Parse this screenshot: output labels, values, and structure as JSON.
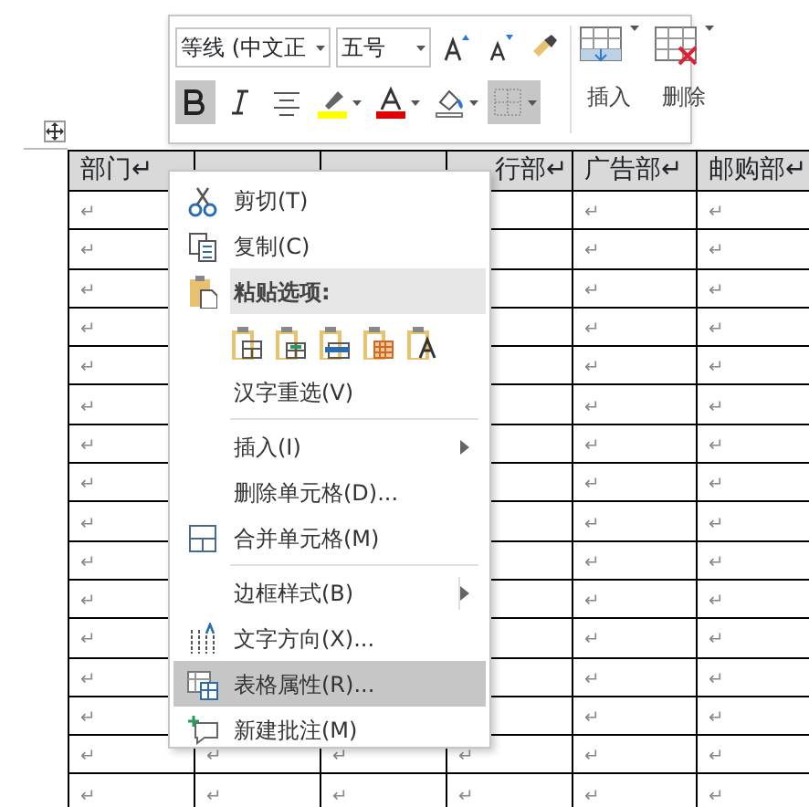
{
  "toolbar": {
    "font": {
      "value": "等线 (中文正"
    },
    "size": {
      "value": "五号"
    },
    "row1": [
      {
        "kind": "grow-font"
      },
      {
        "kind": "shrink-font"
      },
      {
        "kind": "format-painter"
      }
    ],
    "row2": [
      {
        "kind": "bold",
        "pressed": true
      },
      {
        "kind": "italic",
        "pressed": false
      },
      {
        "kind": "center",
        "pressed": false
      },
      {
        "kind": "highlight",
        "pressed": false,
        "dropdown": true
      },
      {
        "kind": "font-color",
        "pressed": false,
        "dropdown": true
      },
      {
        "kind": "shading",
        "pressed": false,
        "dropdown": true
      },
      {
        "kind": "borders",
        "pressed": true,
        "dropdown": true
      }
    ],
    "big": [
      {
        "kind": "insert",
        "label": "插入"
      },
      {
        "kind": "delete",
        "label": "删除"
      }
    ]
  },
  "table": {
    "columns": [
      {
        "header": "部门↵",
        "selected": true
      },
      {
        "selected": true
      },
      {
        "selected": true
      },
      {
        "header": "行部↵",
        "selected": true
      },
      {
        "header": "广告部↵",
        "selected": true
      },
      {
        "header": "邮购部↵",
        "selected": true
      }
    ],
    "rows": [
      [
        "↵",
        null,
        null,
        null,
        "↵",
        "↵"
      ],
      [
        "↵",
        null,
        null,
        null,
        "↵",
        "↵"
      ],
      [
        "↵",
        null,
        null,
        null,
        "↵",
        "↵"
      ],
      [
        "↵",
        null,
        null,
        null,
        "↵",
        "↵"
      ],
      [
        "↵",
        null,
        null,
        null,
        "↵",
        "↵"
      ],
      [
        "↵",
        null,
        null,
        null,
        "↵",
        "↵"
      ],
      [
        "↵",
        null,
        null,
        null,
        "↵",
        "↵"
      ],
      [
        "↵",
        null,
        null,
        null,
        "↵",
        "↵"
      ],
      [
        "↵",
        null,
        null,
        null,
        "↵",
        "↵"
      ],
      [
        "↵",
        null,
        null,
        null,
        "↵",
        "↵"
      ],
      [
        "↵",
        null,
        null,
        null,
        "↵",
        "↵"
      ],
      [
        "↵",
        null,
        null,
        null,
        "↵",
        "↵"
      ],
      [
        "↵",
        null,
        null,
        null,
        "↵",
        "↵"
      ],
      [
        "↵",
        null,
        null,
        null,
        "↵",
        "↵"
      ],
      [
        "↵",
        "↵",
        "↵",
        "↵",
        "↵",
        "↵"
      ],
      [
        "↵",
        "↵",
        "↵",
        "↵",
        "↵",
        "↵"
      ]
    ]
  },
  "context_menu": [
    {
      "kind": "cut",
      "label": "剪切(T)",
      "selected": false
    },
    {
      "kind": "copy",
      "label": "复制(C)",
      "selected": false
    },
    {
      "kind": "paste-header",
      "label": "粘贴选项:"
    },
    {
      "kind": "paste-options",
      "options": [
        {
          "kind": "keep-source"
        },
        {
          "kind": "nest"
        },
        {
          "kind": "merge"
        },
        {
          "kind": "overwrite"
        },
        {
          "kind": "text-only"
        }
      ]
    },
    {
      "kind": "item",
      "label": "汉字重选(V)",
      "selected": false
    },
    {
      "kind": "separator"
    },
    {
      "kind": "item",
      "label": "插入(I)",
      "submenu": true,
      "selected": false
    },
    {
      "kind": "item",
      "label": "删除单元格(D)...",
      "selected": false
    },
    {
      "kind": "merge",
      "label": "合并单元格(M)",
      "selected": false
    },
    {
      "kind": "separator"
    },
    {
      "kind": "item",
      "label": "边框样式(B)",
      "submenu": true,
      "split": true,
      "selected": false
    },
    {
      "kind": "direction",
      "label": "文字方向(X)...",
      "selected": false
    },
    {
      "kind": "properties",
      "label": "表格属性(R)...",
      "selected": true
    },
    {
      "kind": "comment",
      "label": "新建批注(M)",
      "selected": false
    }
  ]
}
